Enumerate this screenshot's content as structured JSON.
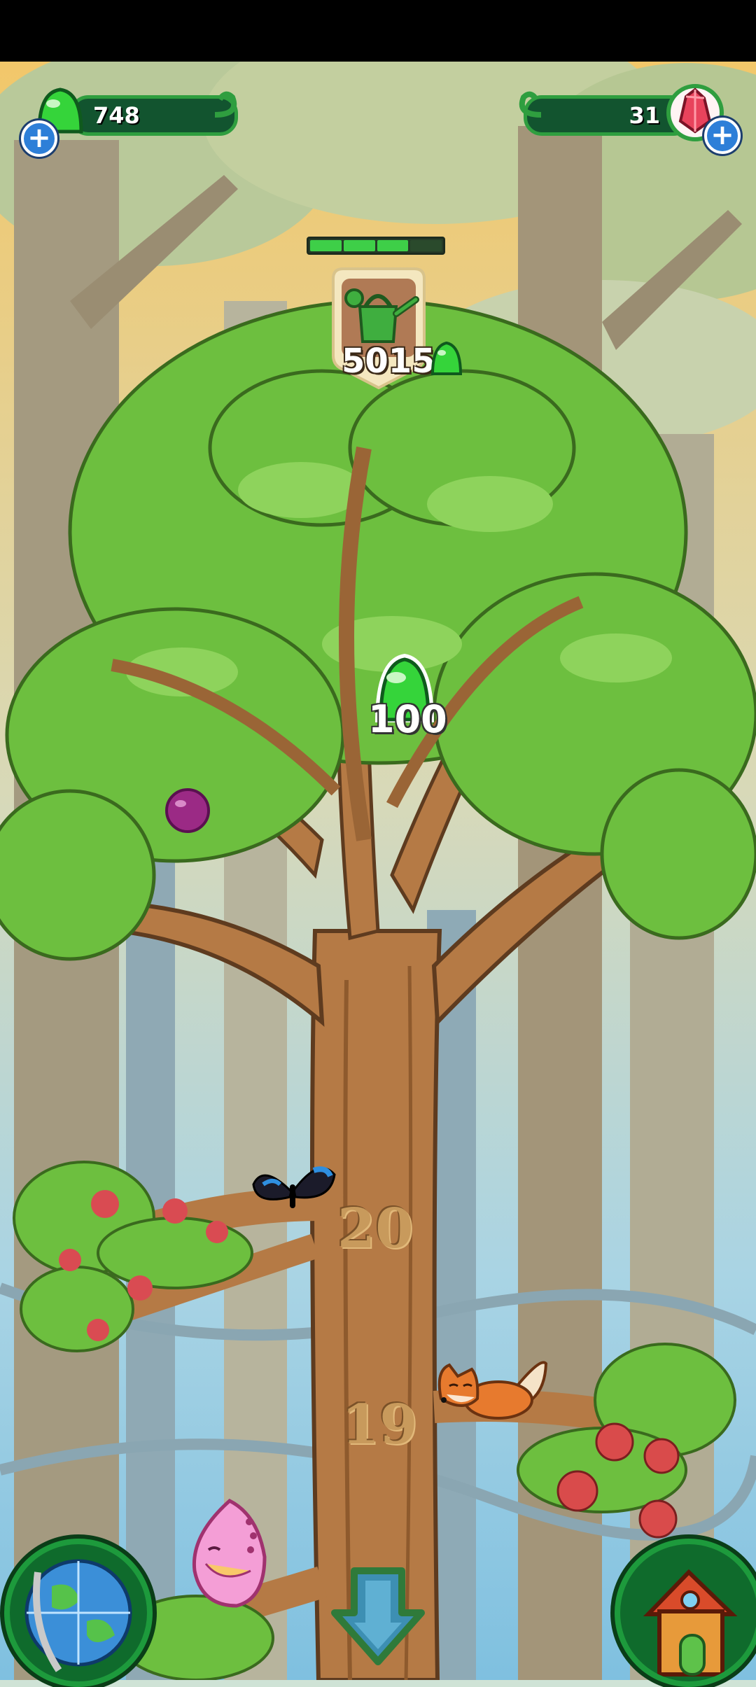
{
  "resources": {
    "jelly": {
      "count": "748",
      "icon": "green-jelly-icon"
    },
    "crystals": {
      "count": "31",
      "icon": "red-crystal-icon"
    }
  },
  "upgrade": {
    "progress_filled": 3,
    "progress_total": 4,
    "icon": "watering-can-icon",
    "price": "5015",
    "price_icon": "green-jelly-icon"
  },
  "reward": {
    "amount": "100",
    "icon": "green-jelly-icon"
  },
  "tree_levels": [
    "20",
    "19"
  ],
  "creatures": [
    "butterfly-icon",
    "fox-icon",
    "pink-fish-icon",
    "purple-berry-icon"
  ],
  "buttons": {
    "left": "globe-icon",
    "center": "down-arrow-icon",
    "right": "house-icon"
  },
  "colors": {
    "leaf": "#6dbf3f",
    "trunk": "#b57a45",
    "jelly": "#35d43a",
    "sky": "#9fd2e8"
  }
}
